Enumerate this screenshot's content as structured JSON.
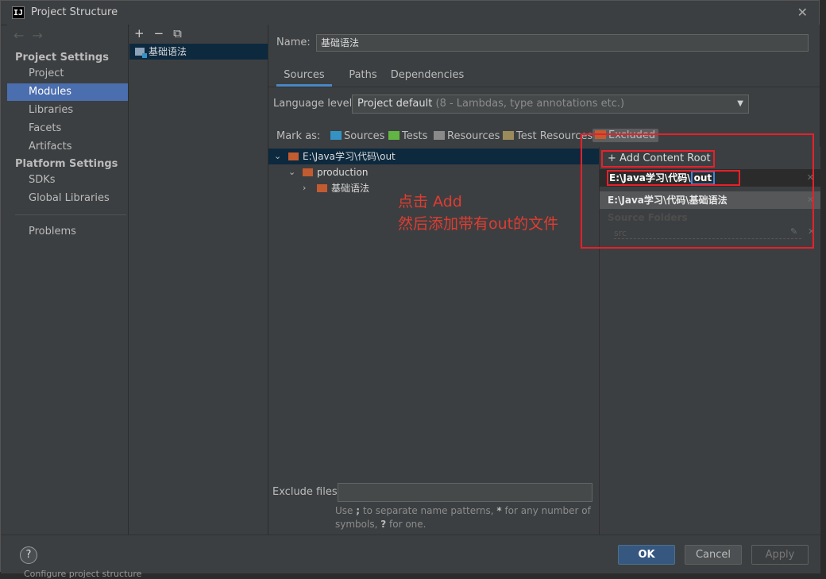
{
  "window": {
    "title": "Project Structure",
    "close": "✕"
  },
  "nav": {
    "project_settings": "Project Settings",
    "items_top": [
      "Project",
      "Modules",
      "Libraries",
      "Facets",
      "Artifacts"
    ],
    "platform_settings": "Platform Settings",
    "items_platform": [
      "SDKs",
      "Global Libraries"
    ],
    "problems": "Problems",
    "back": "←",
    "forward": "→"
  },
  "modules": {
    "toolbar": {
      "add": "+",
      "remove": "−",
      "copy": "⧉"
    },
    "item": "基础语法"
  },
  "main": {
    "name_label": "Name:",
    "name_value": "基础语法",
    "tabs": [
      "Sources",
      "Paths",
      "Dependencies"
    ],
    "language_label": "Language level:",
    "language_value": "Project default",
    "language_hint": "(8 - Lambdas, type annotations etc.)",
    "mark_as_label": "Mark as:",
    "mark_buttons": [
      "Sources",
      "Tests",
      "Resources",
      "Test Resources",
      "Excluded"
    ],
    "tree": [
      "E:\\Java学习\\代码\\out",
      "production",
      "基础语法"
    ],
    "exclude_label": "Exclude files:",
    "exclude_hint_1": "Use ",
    "exclude_hint_semicolon": ";",
    "exclude_hint_2": " to separate name patterns, ",
    "exclude_hint_star": "*",
    "exclude_hint_3": " for any number of symbols, ",
    "exclude_hint_q": "?",
    "exclude_hint_4": " for one."
  },
  "right": {
    "add_content_root": "Add Content Root",
    "root1_prefix": "E:\\Java学习\\代码\\",
    "root1_highlight": "out",
    "root2": "E:\\Java学习\\代码\\基础语法",
    "source_folders": "Source Folders",
    "src": "src"
  },
  "annotation": {
    "line1": "点击 Add",
    "line2": "然后添加带有out的文件"
  },
  "buttons": {
    "help": "?",
    "ok": "OK",
    "cancel": "Cancel",
    "apply": "Apply"
  },
  "footer": "Configure project structure",
  "colors": {
    "accent": "#4b6eaf",
    "annotation": "#e8202a",
    "ok": "#365880"
  }
}
